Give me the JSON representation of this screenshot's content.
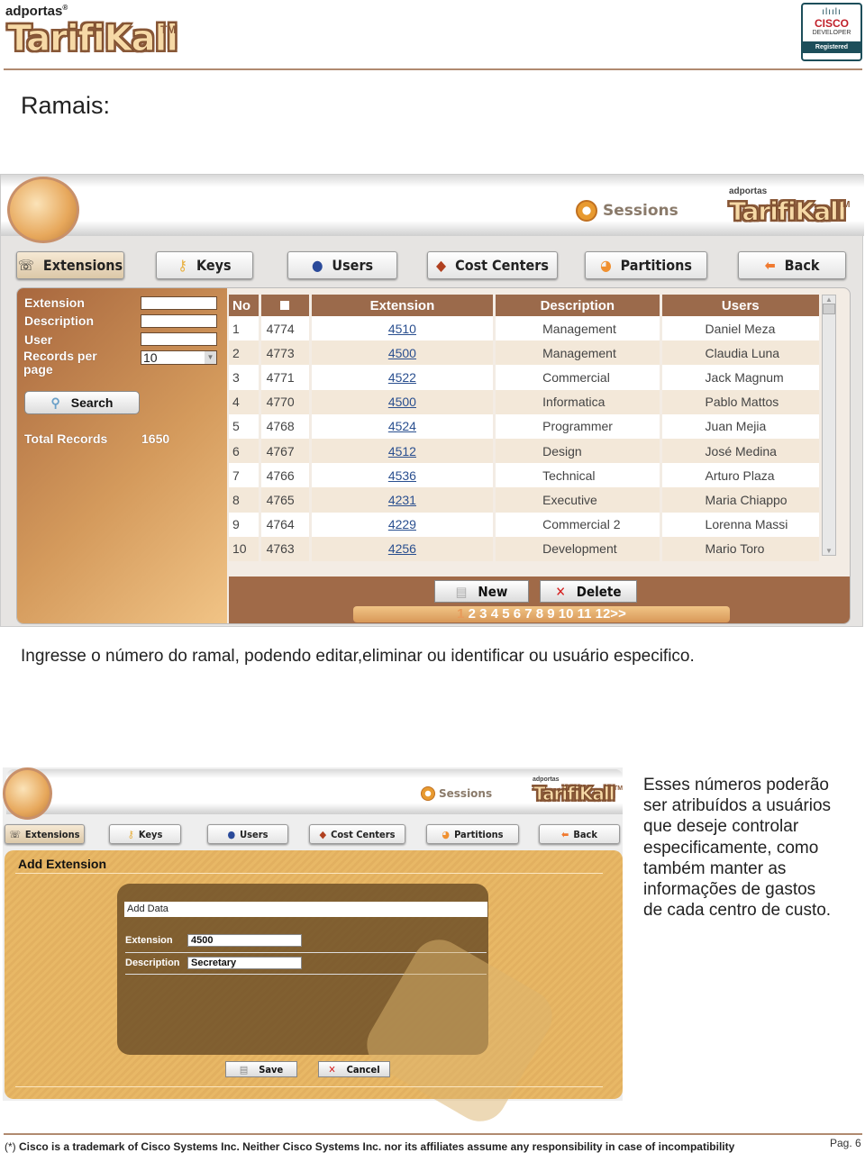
{
  "header": {
    "brand_small": "adportas",
    "brand_mark": "®",
    "logo_text": "TarifiKall",
    "logo_tm": "TM",
    "cisco_badge": {
      "brand": "CISCO",
      "line2": "DEVELOPER",
      "line3": "Registered"
    }
  },
  "section_title": "Ramais:",
  "app": {
    "sessions_label": "Sessions",
    "logo_small": "adportas",
    "logo_text": "TarifiKall",
    "logo_tm": "TM",
    "nav": [
      {
        "label": "Extensions",
        "icon": "phone-icon",
        "active": true
      },
      {
        "label": "Keys",
        "icon": "key-icon"
      },
      {
        "label": "Users",
        "icon": "user-icon"
      },
      {
        "label": "Cost Centers",
        "icon": "cost-centers-icon"
      },
      {
        "label": "Partitions",
        "icon": "pie-chart-icon"
      },
      {
        "label": "Back",
        "icon": "back-arrow-icon"
      }
    ],
    "filters": {
      "extension_label": "Extension",
      "extension_value": "",
      "description_label": "Description",
      "description_value": "",
      "user_label": "User",
      "user_value": "",
      "records_label_1": "Records per",
      "records_label_2": "page",
      "records_value": "10",
      "search_label": "Search",
      "total_label": "Total Records",
      "total_value": "1650"
    },
    "table": {
      "headers": [
        "No",
        "",
        "Extension",
        "Description",
        "Users"
      ],
      "rows": [
        [
          "1",
          "4774",
          "4510",
          "Management",
          "Daniel Meza"
        ],
        [
          "2",
          "4773",
          "4500",
          "Management",
          "Claudia Luna"
        ],
        [
          "3",
          "4771",
          "4522",
          "Commercial",
          "Jack Magnum"
        ],
        [
          "4",
          "4770",
          "4500",
          "Informatica",
          "Pablo Mattos"
        ],
        [
          "5",
          "4768",
          "4524",
          "Programmer",
          "Juan Mejia"
        ],
        [
          "6",
          "4767",
          "4512",
          "Design",
          "José Medina"
        ],
        [
          "7",
          "4766",
          "4536",
          "Technical",
          "Arturo Plaza"
        ],
        [
          "8",
          "4765",
          "4231",
          "Executive",
          "Maria Chiappo"
        ],
        [
          "9",
          "4764",
          "4229",
          "Commercial 2",
          "Lorenna Massi"
        ],
        [
          "10",
          "4763",
          "4256",
          "Development",
          "Mario Toro"
        ]
      ]
    },
    "new_label": "New",
    "delete_label": "Delete",
    "pagination": {
      "current": "1",
      "pages": "2 3 4 5 6 7 8 9 10 11 12>>"
    }
  },
  "paragraph1": "Ingresse o número do ramal, podendo editar,eliminar ou identificar ou usuário especifico.",
  "app2": {
    "sessions_label": "Sessions",
    "logo_small": "adportas",
    "logo_text": "TarifiKall",
    "logo_tm": "TM",
    "nav": [
      "Extensions",
      "Keys",
      "Users",
      "Cost Centers",
      "Partitions",
      "Back"
    ],
    "title": "Add Extension",
    "add_data_label": "Add Data",
    "extension_label": "Extension",
    "extension_value": "4500",
    "description_label": "Description",
    "description_value": "Secretary",
    "save_label": "Save",
    "cancel_label": "Cancel"
  },
  "side_text": [
    "Esses números poderão",
    "ser atribuídos a usuários",
    "que deseje controlar",
    "especificamente, como",
    "também manter as",
    "informações de gastos",
    "de cada centro de custo."
  ],
  "footer": {
    "note_mark": "(*)",
    "note": "Cisco is a trademark of Cisco Systems Inc. Neither Cisco Systems Inc. nor its affiliates assume any responsibility in case of incompatibility",
    "page": "Pag. 6"
  },
  "colors": {
    "brown": "#9b6a4b",
    "orange": "#e2b060",
    "link": "#2a4f8f",
    "cisco": "#1d4e5a"
  }
}
